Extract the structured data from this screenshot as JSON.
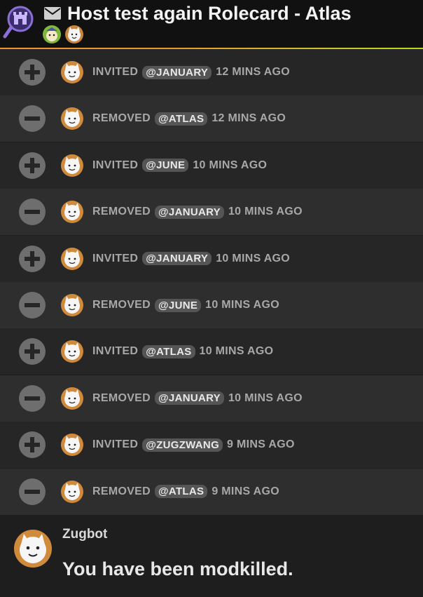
{
  "header": {
    "title": "Host test again Rolecard - Atlas",
    "icons": {
      "badge": "castle-magnifier-icon",
      "mail": "envelope-icon"
    },
    "participants": [
      "avatar-atlas",
      "avatar-battle-cat"
    ]
  },
  "events": [
    {
      "action": "plus",
      "verb": "INVITED",
      "user": "@JANUARY",
      "time": "12 MINS AGO"
    },
    {
      "action": "minus",
      "verb": "REMOVED",
      "user": "@ATLAS",
      "time": "12 MINS AGO"
    },
    {
      "action": "plus",
      "verb": "INVITED",
      "user": "@JUNE",
      "time": "10 MINS AGO"
    },
    {
      "action": "minus",
      "verb": "REMOVED",
      "user": "@JANUARY",
      "time": "10 MINS AGO"
    },
    {
      "action": "plus",
      "verb": "INVITED",
      "user": "@JANUARY",
      "time": "10 MINS AGO"
    },
    {
      "action": "minus",
      "verb": "REMOVED",
      "user": "@JUNE",
      "time": "10 MINS AGO"
    },
    {
      "action": "plus",
      "verb": "INVITED",
      "user": "@ATLAS",
      "time": "10 MINS AGO"
    },
    {
      "action": "minus",
      "verb": "REMOVED",
      "user": "@JANUARY",
      "time": "10 MINS AGO"
    },
    {
      "action": "plus",
      "verb": "INVITED",
      "user": "@ZUGZWANG",
      "time": "9 MINS AGO"
    },
    {
      "action": "minus",
      "verb": "REMOVED",
      "user": "@ATLAS",
      "time": "9 MINS AGO"
    }
  ],
  "message": {
    "author": "Zugbot",
    "body": "You have been modkilled."
  },
  "colors": {
    "gradient_start": "#f0922c",
    "gradient_end": "#b7d61f",
    "row_dark": "#262626",
    "row_light": "#2e2e2e"
  }
}
